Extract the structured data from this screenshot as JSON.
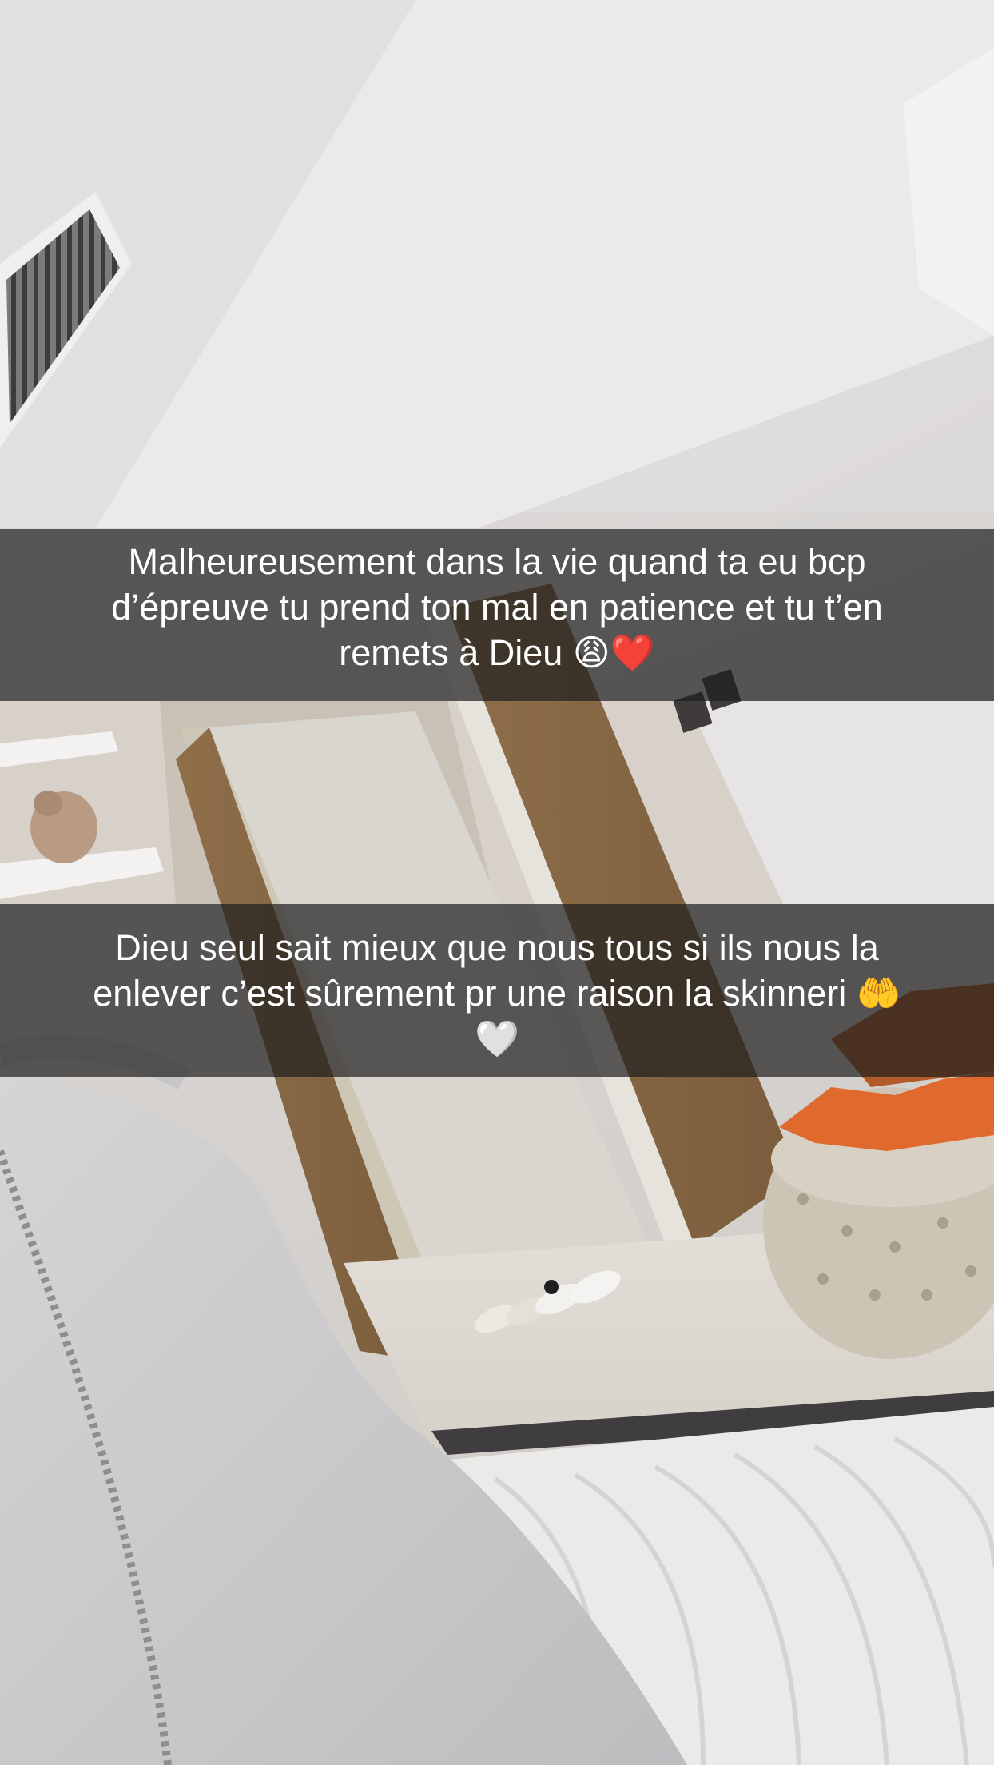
{
  "captions": [
    {
      "lines": [
        "Malheureusement dans la vie quand ta eu bcp",
        "d’épreuve tu prend ton mal en patience et tu t’en",
        "remets à Dieu 😩❤️"
      ]
    },
    {
      "lines": [
        "Dieu seul sait mieux que nous tous si ils nous la",
        "enlever c’est sûrement pr une raison la skinneri 🤲",
        "🤍"
      ]
    }
  ],
  "scene": {
    "description_icons": [
      "air-vent",
      "wooden-door",
      "wall-shelf",
      "vase",
      "pouf",
      "sneakers",
      "blanket",
      "sleeve"
    ]
  }
}
